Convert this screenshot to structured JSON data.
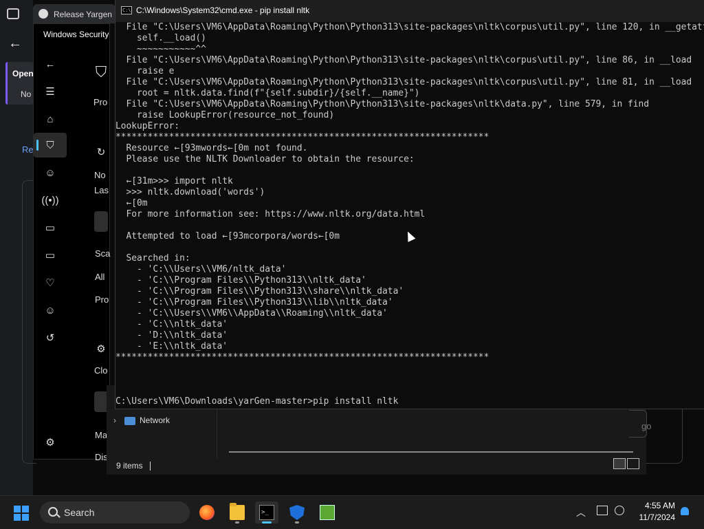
{
  "browser": {
    "tab_title": "Release Yargen D",
    "sidebar_card_title": "Open",
    "sidebar_card_sub": "No",
    "link_text": "Re"
  },
  "windows_security": {
    "title": "Windows Security",
    "texts": [
      "Pro",
      "No",
      "Las",
      "Sca",
      "All",
      "Pro",
      "Clo",
      "Ma",
      "Dis"
    ]
  },
  "cmd": {
    "title": "C:\\Windows\\System32\\cmd.exe - pip  install nltk",
    "lines": [
      "  File \"C:\\Users\\VM6\\AppData\\Roaming\\Python\\Python313\\site-packages\\nltk\\corpus\\util.py\", line 120, in __getattr__",
      "    self.__load()",
      "    ~~~~~~~~~~~^^",
      "  File \"C:\\Users\\VM6\\AppData\\Roaming\\Python\\Python313\\site-packages\\nltk\\corpus\\util.py\", line 86, in __load",
      "    raise e",
      "  File \"C:\\Users\\VM6\\AppData\\Roaming\\Python\\Python313\\site-packages\\nltk\\corpus\\util.py\", line 81, in __load",
      "    root = nltk.data.find(f\"{self.subdir}/{self.__name}\")",
      "  File \"C:\\Users\\VM6\\AppData\\Roaming\\Python\\Python313\\site-packages\\nltk\\data.py\", line 579, in find",
      "    raise LookupError(resource_not_found)",
      "LookupError:",
      "**********************************************************************",
      "  Resource ←[93mwords←[0m not found.",
      "  Please use the NLTK Downloader to obtain the resource:",
      "",
      "  ←[31m>>> import nltk",
      "  >>> nltk.download('words')",
      "  ←[0m",
      "  For more information see: https://www.nltk.org/data.html",
      "",
      "  Attempted to load ←[93mcorpora/words←[0m",
      "",
      "  Searched in:",
      "    - 'C:\\\\Users\\\\VM6/nltk_data'",
      "    - 'C:\\\\Program Files\\\\Python313\\\\nltk_data'",
      "    - 'C:\\\\Program Files\\\\Python313\\\\share\\\\nltk_data'",
      "    - 'C:\\\\Program Files\\\\Python313\\\\lib\\\\nltk_data'",
      "    - 'C:\\\\Users\\\\VM6\\\\AppData\\\\Roaming\\\\nltk_data'",
      "    - 'C:\\\\nltk_data'",
      "    - 'D:\\\\nltk_data'",
      "    - 'E:\\\\nltk_data'",
      "**********************************************************************",
      "",
      "",
      "",
      "C:\\Users\\VM6\\Downloads\\yarGen-master>pip install nltk"
    ]
  },
  "explorer": {
    "nav_item": "Network",
    "status": "9 items",
    "right_partial": "go"
  },
  "taskbar": {
    "search_label": "Search",
    "time": "4:55 AM",
    "date": "11/7/2024"
  },
  "colors": {
    "accent": "#4cc2ff",
    "terminal_bg": "#0c0c0c",
    "terminal_text": "#cccccc"
  }
}
